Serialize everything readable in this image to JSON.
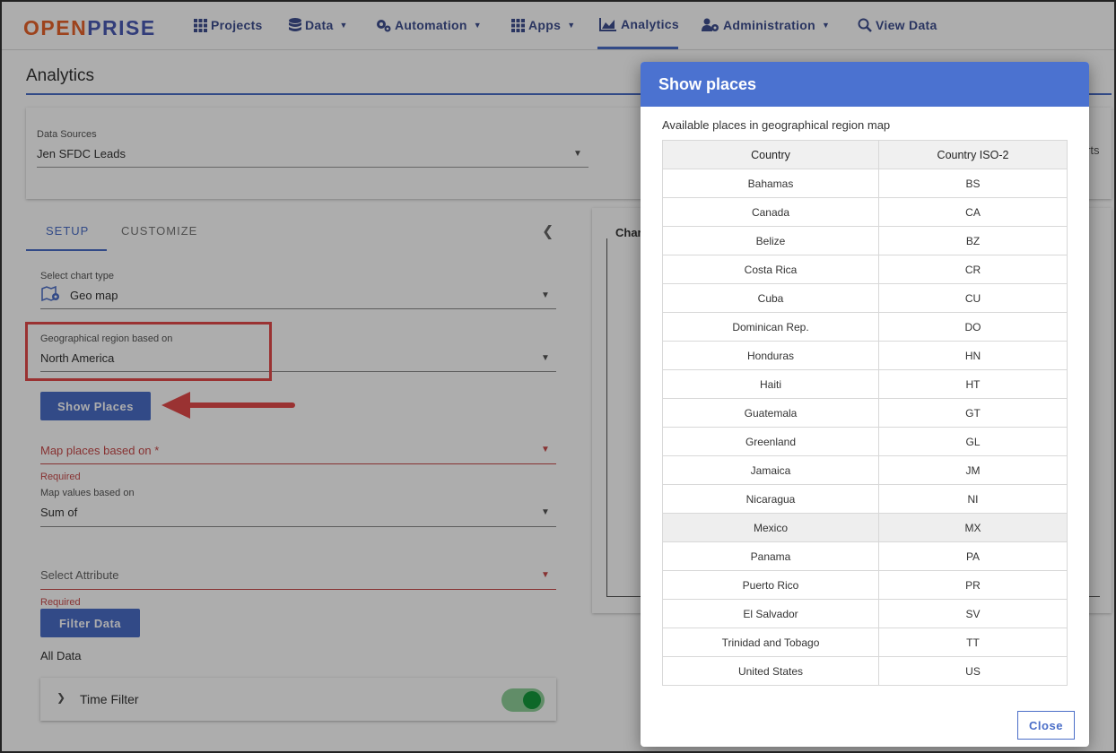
{
  "nav": {
    "logo_part1": "OPEN",
    "logo_part2": "PRISE",
    "items": [
      {
        "label": "Projects",
        "icon": "grid-icon"
      },
      {
        "label": "Data",
        "icon": "database-icon"
      },
      {
        "label": "Automation",
        "icon": "gears-icon"
      },
      {
        "label": "Apps",
        "icon": "apps-grid-icon"
      },
      {
        "label": "Analytics",
        "icon": "area-chart-icon"
      },
      {
        "label": "Administration",
        "icon": "user-gear-icon"
      },
      {
        "label": "View Data",
        "icon": "search-icon"
      }
    ],
    "active": "Analytics"
  },
  "page": {
    "title": "Analytics",
    "data_sources_label": "Data Sources",
    "data_sources_value": "Jen SFDC Leads",
    "right_partial_text": "rts"
  },
  "tabs": {
    "setup": "SETUP",
    "customize": "CUSTOMIZE"
  },
  "setup": {
    "chart_type_label": "Select chart type",
    "chart_type_value": "Geo map",
    "geo_region_label": "Geographical region based on",
    "geo_region_value": "North America",
    "show_places_button": "Show Places",
    "map_places_placeholder": "Map places based on",
    "required_star": "*",
    "required_text": "Required",
    "map_values_label": "Map values based on",
    "map_values_value": "Sum of",
    "select_attribute_placeholder": "Select Attribute",
    "required_text_2": "Required",
    "filter_data_button": "Filter Data",
    "all_data_text": "All Data",
    "time_filter_label": "Time Filter",
    "time_filter_on": true
  },
  "chart": {
    "partial_title": "Char"
  },
  "modal": {
    "title": "Show places",
    "subtitle": "Available places in geographical region map",
    "columns": [
      "Country",
      "Country ISO-2"
    ],
    "rows": [
      [
        "Bahamas",
        "BS"
      ],
      [
        "Canada",
        "CA"
      ],
      [
        "Belize",
        "BZ"
      ],
      [
        "Costa Rica",
        "CR"
      ],
      [
        "Cuba",
        "CU"
      ],
      [
        "Dominican Rep.",
        "DO"
      ],
      [
        "Honduras",
        "HN"
      ],
      [
        "Haiti",
        "HT"
      ],
      [
        "Guatemala",
        "GT"
      ],
      [
        "Greenland",
        "GL"
      ],
      [
        "Jamaica",
        "JM"
      ],
      [
        "Nicaragua",
        "NI"
      ],
      [
        "Mexico",
        "MX"
      ],
      [
        "Panama",
        "PA"
      ],
      [
        "Puerto Rico",
        "PR"
      ],
      [
        "El Salvador",
        "SV"
      ],
      [
        "Trinidad and Tobago",
        "TT"
      ],
      [
        "United States",
        "US"
      ]
    ],
    "highlighted_row": "Mexico",
    "close_button": "Close"
  },
  "colors": {
    "accent": "#4b6ec8",
    "modal_header": "#4b72d0",
    "logo_orange": "#e8632c",
    "required_red": "#c84a4a",
    "annotation_red": "#e34a4a",
    "toggle_green": "#149a3c"
  }
}
